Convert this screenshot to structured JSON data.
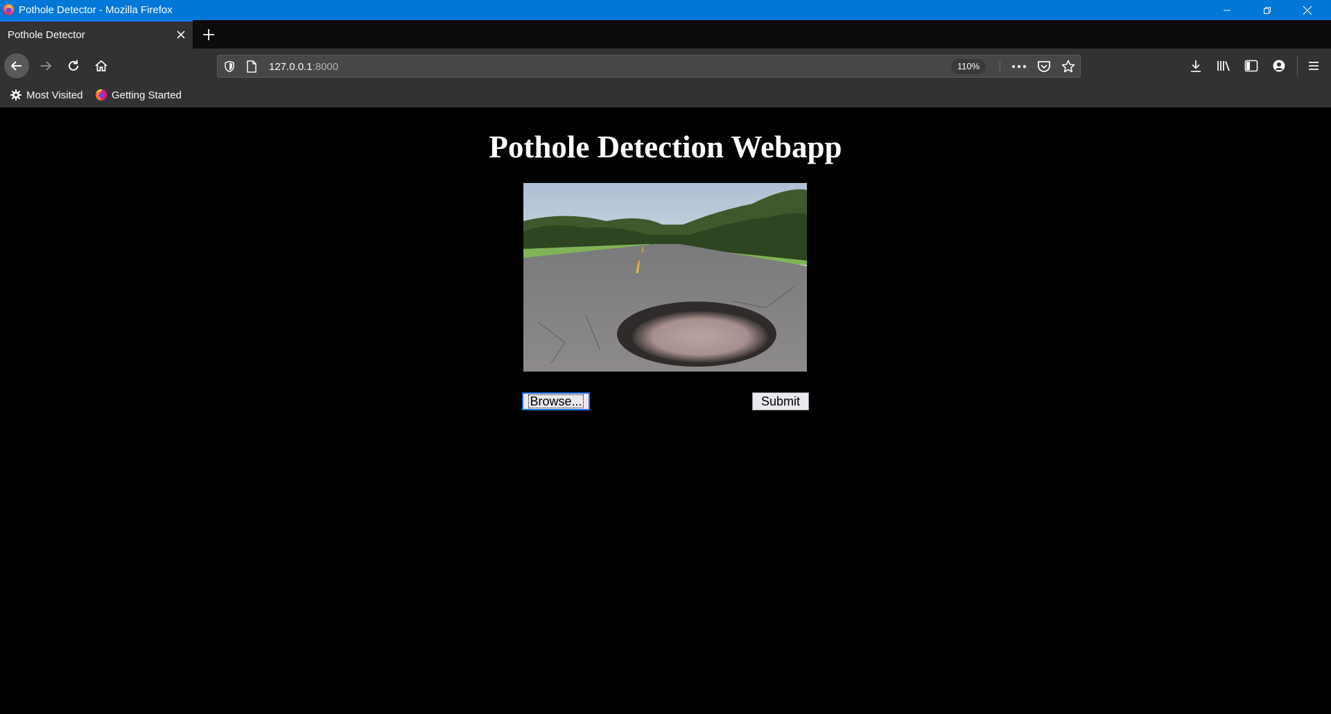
{
  "window": {
    "title": "Pothole Detector - Mozilla Firefox"
  },
  "tabs": [
    {
      "label": "Pothole Detector"
    }
  ],
  "urlbar": {
    "host": "127.0.0.1",
    "port": ":8000",
    "zoom": "110%"
  },
  "bookmarks": [
    {
      "label": "Most Visited",
      "icon": "gear-icon"
    },
    {
      "label": "Getting Started",
      "icon": "firefox-icon"
    }
  ],
  "page": {
    "heading": "Pothole Detection Webapp",
    "browse_label": "Browse...",
    "submit_label": "Submit"
  },
  "colors": {
    "titlebar": "#0078d7",
    "toolbar": "#323234",
    "page_background": "#000000",
    "heading_text": "#ffffff"
  }
}
